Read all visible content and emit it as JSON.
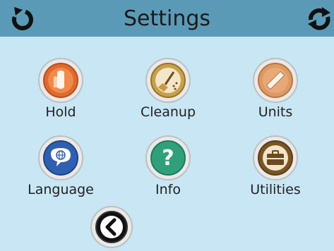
{
  "header": {
    "title": "Settings",
    "left_icon": "power-cycle-icon",
    "right_icon": "refresh-icon"
  },
  "tiles": [
    {
      "label": "Hold",
      "icon": "hold-touch-icon",
      "color": "#e06a2e"
    },
    {
      "label": "Cleanup",
      "icon": "broom-cleanup-icon",
      "color": "#c9a04a"
    },
    {
      "label": "Units",
      "icon": "ruler-icon",
      "color": "#dd9a66"
    },
    {
      "label": "Language",
      "icon": "globe-speech-icon",
      "color": "#2f5fb0"
    },
    {
      "label": "Info",
      "icon": "question-mark-icon",
      "color": "#2fa07a"
    },
    {
      "label": "Utilities",
      "icon": "toolbox-icon",
      "color": "#7a5424"
    }
  ],
  "back": {
    "icon": "chevron-left-icon"
  },
  "colors": {
    "header_bg": "#5b9ab6",
    "content_bg": "#c8e6f3"
  }
}
